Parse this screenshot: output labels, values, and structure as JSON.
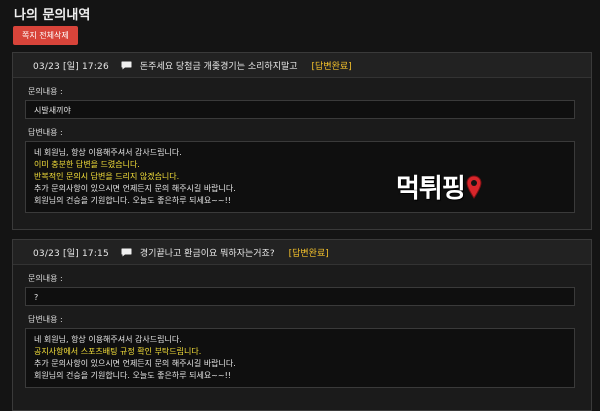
{
  "page": {
    "title": "나의 문의내역"
  },
  "toolbar": {
    "delete_all_label": "쪽지 전체삭제"
  },
  "inquiries": [
    {
      "date": "03/23 [일] 17:26",
      "subject": "돈주세요 당첨금 개좆경기는 소리하지말고",
      "status": "[답변완료]",
      "question_label": "문의내용 :",
      "question": "시발새끼야",
      "answer_label": "답변내용 :",
      "answer_lines": [
        "네 회원님, 항상 이용해주셔서 감사드립니다.",
        "이미 충분한 답변을 드렸습니다.",
        "반복적인 문의시 답변을 드리지 않겠습니다.",
        "추가 문의사항이 있으시면 언제든지 문의 해주시길 바랍니다.",
        "회원님의 건승을 기원합니다. 오늘도 좋은하루 되세요~~!!"
      ],
      "highlight_lines": [
        1,
        2
      ]
    },
    {
      "date": "03/23 [일] 17:15",
      "subject": "경기끝나고 환금이요 뭐하자는거죠?",
      "status": "[답변완료]",
      "question_label": "문의내용 :",
      "question": "?",
      "answer_label": "답변내용 :",
      "answer_lines": [
        "네 회원님, 항상 이용해주셔서 감사드립니다.",
        "공지사항에서 스포츠배팅 규정 확인 부탁드립니다.",
        "추가 문의사항이 있으시면 언제든지 문의 해주시길 바랍니다.",
        "회원님의 건승을 기원합니다. 오늘도 좋은하루 되세요~~!!"
      ],
      "highlight_lines": [
        1
      ]
    }
  ],
  "watermark": {
    "text": "먹튀핑"
  },
  "colors": {
    "accent_red": "#d8443a",
    "status_yellow": "#f5c22b",
    "highlight_yellow": "#f5e03a",
    "background": "#141414"
  },
  "icons": {
    "message": "message-bubble-icon",
    "watermark_pin": "map-pin-icon"
  }
}
